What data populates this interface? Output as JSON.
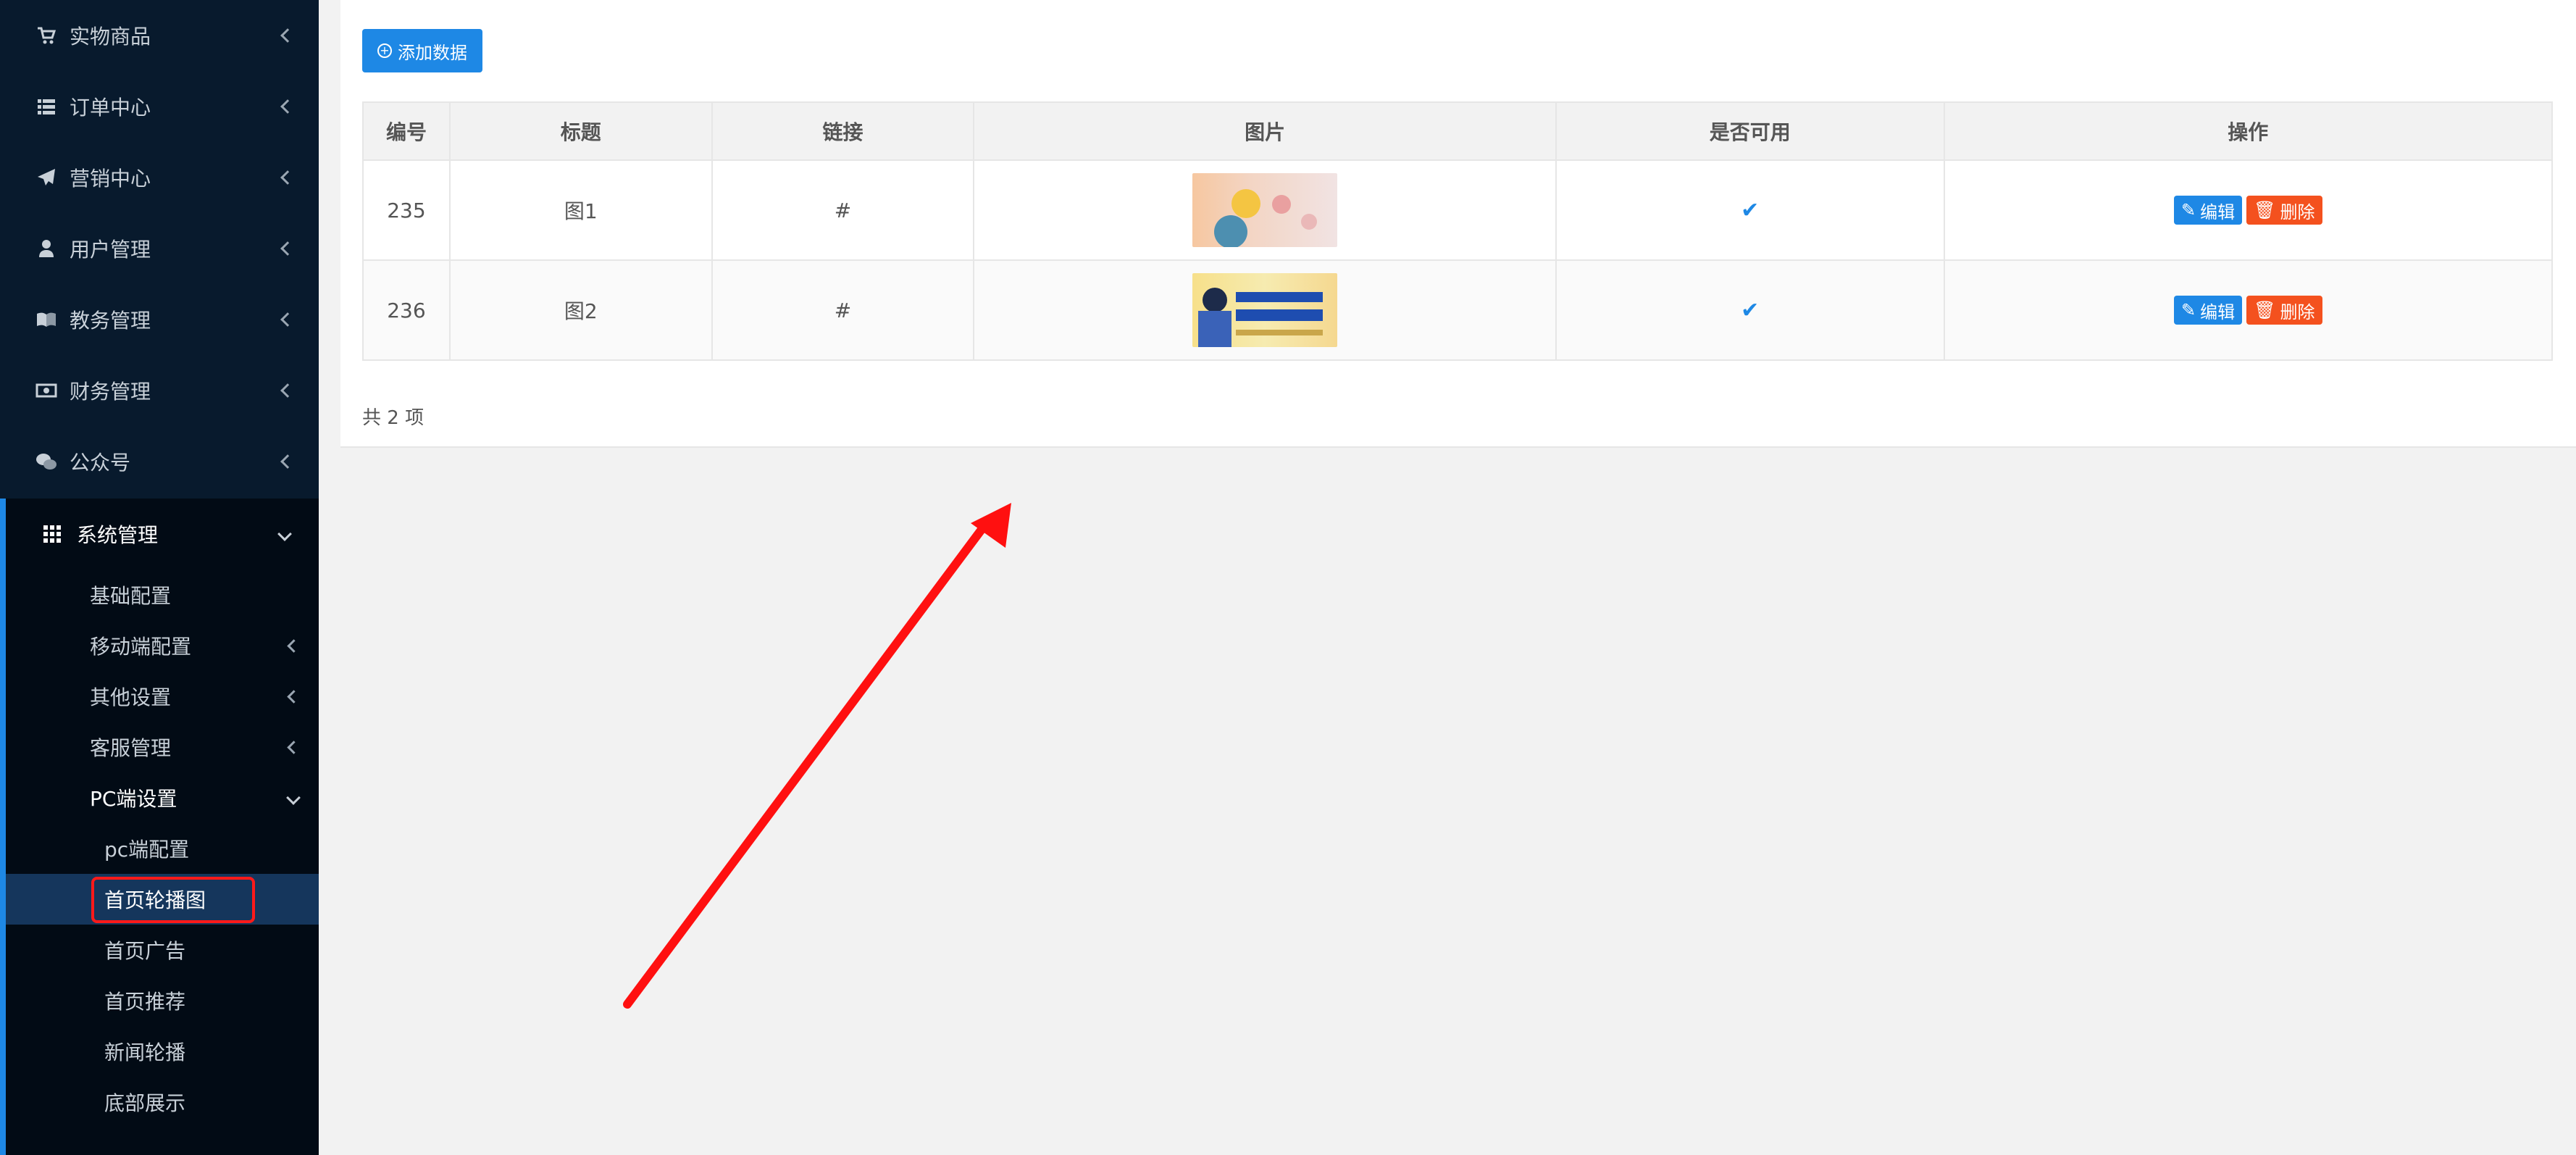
{
  "sidebar": {
    "items": [
      {
        "label": "实物商品",
        "icon": "cart-icon"
      },
      {
        "label": "订单中心",
        "icon": "list-icon"
      },
      {
        "label": "营销中心",
        "icon": "paper-plane-icon"
      },
      {
        "label": "用户管理",
        "icon": "user-icon"
      },
      {
        "label": "教务管理",
        "icon": "book-icon"
      },
      {
        "label": "财务管理",
        "icon": "money-icon"
      },
      {
        "label": "公众号",
        "icon": "wechat-icon"
      }
    ],
    "system": {
      "label": "系统管理",
      "icon": "grid-icon",
      "children": [
        {
          "label": "基础配置"
        },
        {
          "label": "移动端配置"
        },
        {
          "label": "其他设置"
        },
        {
          "label": "客服管理"
        },
        {
          "label": "PC端设置"
        }
      ],
      "pc_children": [
        {
          "label": "pc端配置"
        },
        {
          "label": "首页轮播图"
        },
        {
          "label": "首页广告"
        },
        {
          "label": "首页推荐"
        },
        {
          "label": "新闻轮播"
        },
        {
          "label": "底部展示"
        }
      ]
    }
  },
  "toolbar": {
    "add_label": "添加数据"
  },
  "table": {
    "headers": [
      "编号",
      "标题",
      "链接",
      "图片",
      "是否可用",
      "操作"
    ],
    "rows": [
      {
        "id": "235",
        "title": "图1",
        "link": "#",
        "enabled": true
      },
      {
        "id": "236",
        "title": "图2",
        "link": "#",
        "enabled": true
      }
    ],
    "edit_label": "编辑",
    "delete_label": "删除"
  },
  "footer": {
    "total": "共 2 项"
  },
  "colors": {
    "accent": "#1e88e5",
    "danger": "#f4511e",
    "sidebar": "#081a2d",
    "highlight": "#ff1a1a"
  }
}
